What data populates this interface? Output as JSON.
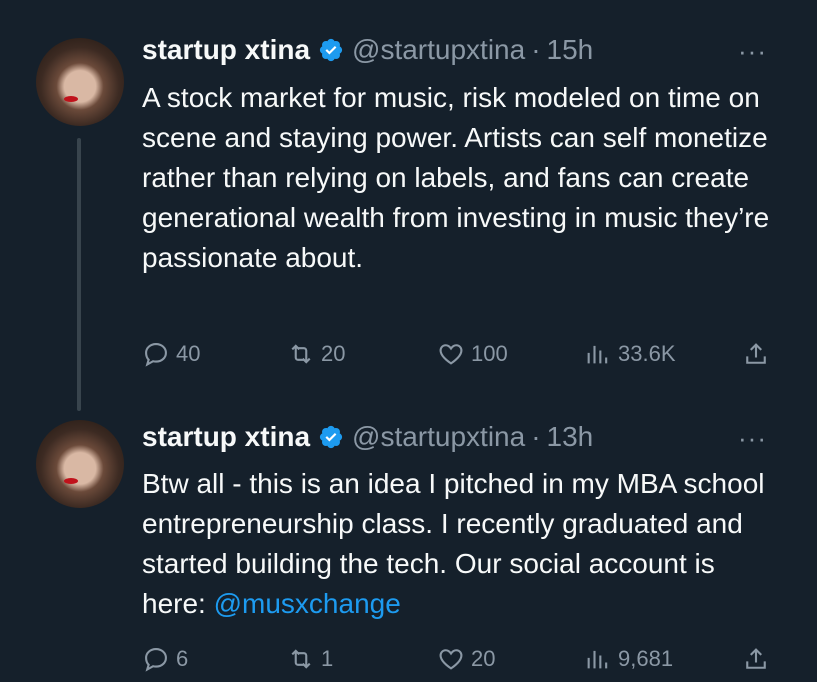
{
  "tweets": [
    {
      "name": "startup xtina",
      "handle": "@startupxtina",
      "dot": "·",
      "time": "15h",
      "text": "A stock market for music, risk modeled on time on scene and staying power. Artists can self monetize rather than relying on labels, and fans can create generational wealth from investing in music they’re passionate about.",
      "replies": "40",
      "retweets": "20",
      "likes": "100",
      "views": "33.6K",
      "more": "···"
    },
    {
      "name": "startup xtina",
      "handle": "@startupxtina",
      "dot": "·",
      "time": "13h",
      "text": "Btw all - this is an idea I pitched in my MBA school entrepreneurship class. I recently graduated and started building the tech. Our social account is here: ",
      "mention": "@musxchange",
      "replies": "6",
      "retweets": "1",
      "likes": "20",
      "views": "9,681",
      "more": "···"
    }
  ],
  "colors": {
    "background": "#15202b",
    "muted": "#8b98a5",
    "link": "#1d9bf0",
    "verified": "#1d9bf0"
  }
}
